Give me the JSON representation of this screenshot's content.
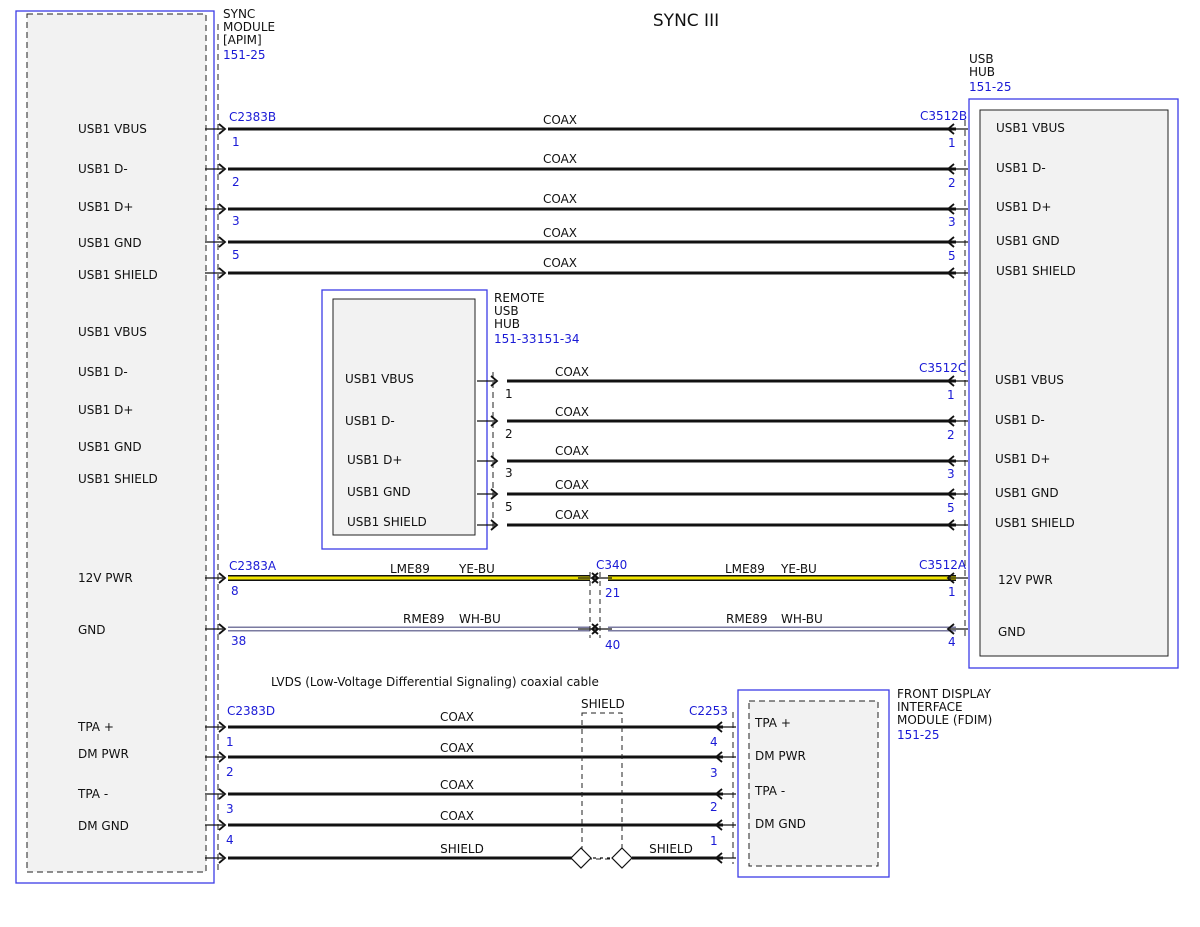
{
  "title": "SYNC III",
  "modules": {
    "apim": {
      "lines": [
        "SYNC",
        "MODULE",
        "[APIM]"
      ],
      "ref": "151-25",
      "pins": [
        "USB1 VBUS",
        "USB1 D-",
        "USB1 D+",
        "USB1 GND",
        "USB1 SHIELD",
        "USB1 VBUS",
        "USB1 D-",
        "USB1 D+",
        "USB1 GND",
        "USB1 SHIELD",
        "12V PWR",
        "GND",
        "TPA +",
        "DM PWR",
        "TPA -",
        "DM GND"
      ]
    },
    "usb_hub": {
      "lines": [
        "USB",
        "HUB"
      ],
      "ref": "151-25",
      "pins": [
        "USB1 VBUS",
        "USB1 D-",
        "USB1 D+",
        "USB1 GND",
        "USB1 SHIELD",
        "USB1 VBUS",
        "USB1 D-",
        "USB1 D+",
        "USB1 GND",
        "USB1 SHIELD",
        "12V PWR",
        "GND"
      ]
    },
    "remote_usb_hub": {
      "lines": [
        "REMOTE",
        "USB",
        "HUB"
      ],
      "refs": [
        "151-33",
        "151-34"
      ],
      "pins": [
        "USB1 VBUS",
        "USB1 D-",
        "USB1 D+",
        "USB1 GND",
        "USB1 SHIELD"
      ]
    },
    "fdim": {
      "lines": [
        "FRONT DISPLAY",
        "INTERFACE",
        "MODULE (FDIM)"
      ],
      "ref": "151-25",
      "pins": [
        "TPA +",
        "DM PWR",
        "TPA -",
        "DM GND"
      ]
    }
  },
  "connectors": {
    "c2383b": {
      "name": "C2383B",
      "pins": [
        "1",
        "2",
        "3",
        "5"
      ]
    },
    "c3512b": {
      "name": "C3512B",
      "pins": [
        "1",
        "2",
        "3",
        "5"
      ]
    },
    "c3512c": {
      "name": "C3512C",
      "pins": [
        "1",
        "2",
        "3",
        "5"
      ]
    },
    "remote_pins": [
      "1",
      "2",
      "3",
      "5"
    ],
    "c2383a": {
      "name": "C2383A",
      "pins": [
        "8",
        "38"
      ]
    },
    "c340": {
      "name": "C340",
      "pins": [
        "21",
        "40"
      ]
    },
    "c3512a": {
      "name": "C3512A",
      "pins": [
        "1",
        "4"
      ]
    },
    "c2383d": {
      "name": "C2383D",
      "pins": [
        "1",
        "2",
        "3",
        "4"
      ]
    },
    "c2253": {
      "name": "C2253",
      "pins": [
        "4",
        "3",
        "2",
        "1"
      ]
    }
  },
  "wires": {
    "coax": "COAX",
    "shield": "SHIELD",
    "pwr_circuit": "LME89",
    "pwr_color": "YE-BU",
    "gnd_circuit": "RME89",
    "gnd_color": "WH-BU"
  },
  "notes": {
    "lvds": "LVDS (Low-Voltage Differential Signaling) coaxial cable"
  },
  "colors": {
    "module_outline": "#3c3ce6",
    "connector_ref": "#1a1ad6",
    "wire": "#111111",
    "pwr_wire_fill": "#f2e600",
    "gnd_wire_fill": "#ffffff",
    "module_fill": "#f2f2f2"
  }
}
